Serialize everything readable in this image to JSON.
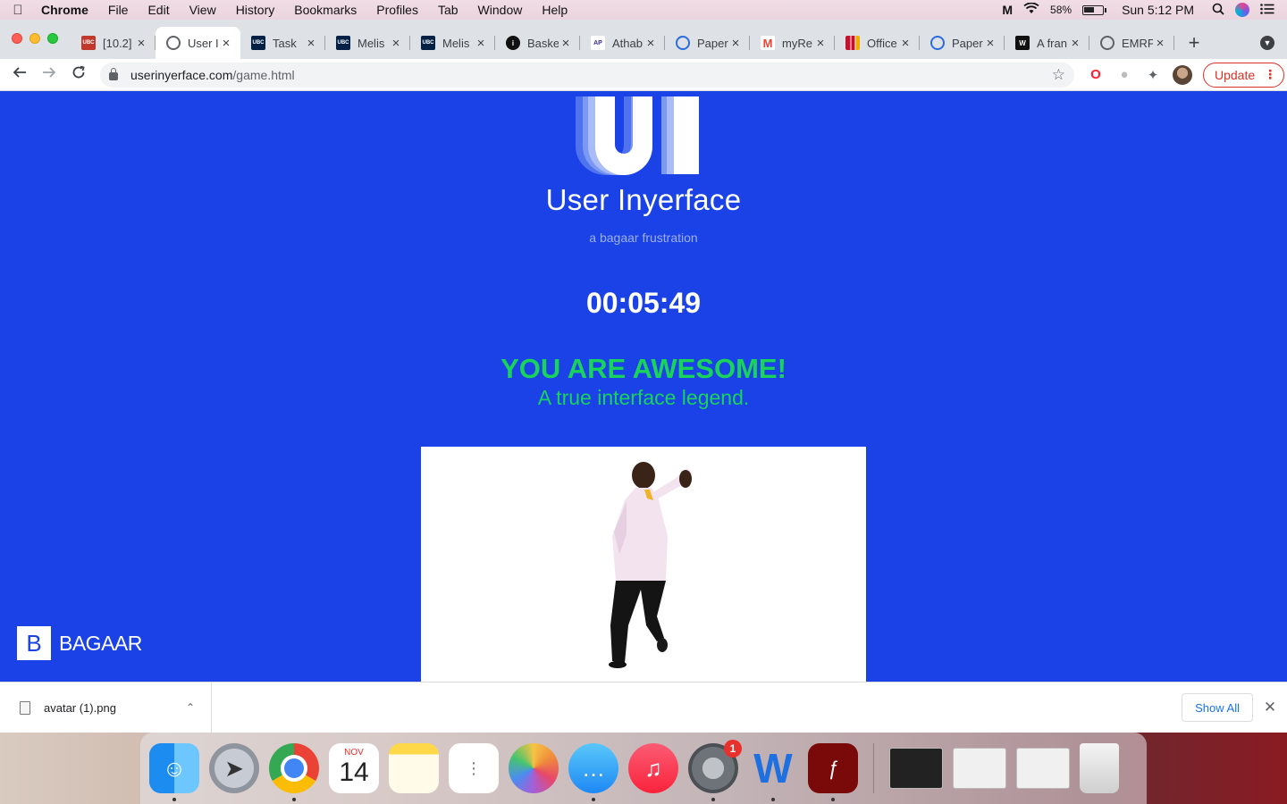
{
  "menubar": {
    "app": "Chrome",
    "items": [
      "File",
      "Edit",
      "View",
      "History",
      "Bookmarks",
      "Profiles",
      "Tab",
      "Window",
      "Help"
    ],
    "battery": "58%",
    "clock": "Sun 5:12 PM"
  },
  "tabs": [
    {
      "label": "[10.2]",
      "favicon": "UBC",
      "color": "#c0392b"
    },
    {
      "label": "User Inyerface",
      "favicon": "globe",
      "color": "#5f6368",
      "active": true
    },
    {
      "label": "Task",
      "favicon": "UBC",
      "color": "#002145"
    },
    {
      "label": "Melis",
      "favicon": "UBC",
      "color": "#002145"
    },
    {
      "label": "Melis",
      "favicon": "UBC",
      "color": "#002145"
    },
    {
      "label": "Basket",
      "favicon": "i",
      "color": "#111111"
    },
    {
      "label": "Athab",
      "favicon": "AP",
      "color": "#ffffff"
    },
    {
      "label": "Paper",
      "favicon": "P",
      "color": "#2b6de0"
    },
    {
      "label": "myRe",
      "favicon": "M",
      "color": "#ffffff"
    },
    {
      "label": "Office",
      "favicon": "bars",
      "color": "#ffffff"
    },
    {
      "label": "Paper",
      "favicon": "P",
      "color": "#2b6de0"
    },
    {
      "label": "A fran",
      "favicon": "W",
      "color": "#111111"
    },
    {
      "label": "EMRF",
      "favicon": "globe",
      "color": "#5f6368"
    }
  ],
  "toolbar": {
    "url_host": "userinyerface.com",
    "url_path": "/game.html",
    "update_label": "Update"
  },
  "page": {
    "logo_letters": "UI",
    "title": "User Inyerface",
    "subtitle": "a bagaar frustration",
    "timer": "00:05:49",
    "headline": "YOU ARE AWESOME!",
    "tagline": "A true interface legend.",
    "brand_letter": "B",
    "brand_name": "BAGAAR",
    "bg_color": "#1a42e6",
    "accent_color": "#19d35a"
  },
  "downloads": {
    "file_name": "avatar (1).png",
    "show_all": "Show All"
  },
  "dock": {
    "calendar_month": "NOV",
    "calendar_day": "14",
    "prefs_badge": "1"
  }
}
